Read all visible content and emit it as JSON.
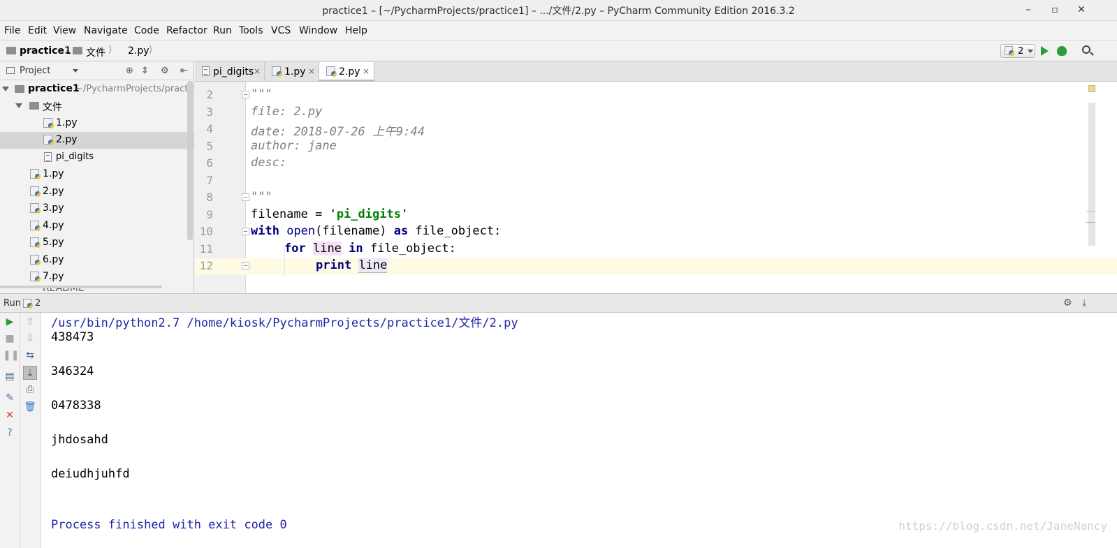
{
  "window": {
    "title": "practice1 – [~/PycharmProjects/practice1] – .../文件/2.py – PyCharm Community Edition 2016.3.2",
    "minimize": "–",
    "maximize": "▫",
    "close": "✕"
  },
  "menu": [
    "File",
    "Edit",
    "View",
    "Navigate",
    "Code",
    "Refactor",
    "Run",
    "Tools",
    "VCS",
    "Window",
    "Help"
  ],
  "breadcrumb": [
    "practice1",
    "文件",
    "2.py"
  ],
  "run_config": {
    "name": "2"
  },
  "project_panel": {
    "title": "Project",
    "root": {
      "name": "practice1",
      "path": "~/PycharmProjects/practic"
    },
    "items": [
      {
        "label": "文件"
      },
      {
        "label": "1.py"
      },
      {
        "label": "2.py",
        "selected": true
      },
      {
        "label": "pi_digits"
      },
      {
        "label": "1.py"
      },
      {
        "label": "2.py"
      },
      {
        "label": "3.py"
      },
      {
        "label": "4.py"
      },
      {
        "label": "5.py"
      },
      {
        "label": "6.py"
      },
      {
        "label": "7.py"
      },
      {
        "label": "README"
      }
    ]
  },
  "tabs": [
    {
      "label": "pi_digits"
    },
    {
      "label": "1.py"
    },
    {
      "label": "2.py",
      "active": true
    }
  ],
  "tab_close": "×",
  "editor": {
    "line_numbers": [
      "2",
      "3",
      "4",
      "5",
      "6",
      "7",
      "8",
      "9",
      "10",
      "11",
      "12"
    ],
    "doc_open": "\"\"\"",
    "doc_file": "file: 2.py",
    "doc_date": "date: 2018-07-26 上午9:44",
    "doc_author": "author: jane",
    "doc_desc": "desc:",
    "doc_close": "\"\"\"",
    "l9_var": "filename = ",
    "l9_str": "'pi_digits'",
    "l10_with": "with",
    "l10_open": "open",
    "l10_mid": "(filename) ",
    "l10_as": "as",
    "l10_end": " file_object:",
    "l11_for": "for",
    "l11_var": "line",
    "l11_in": "in",
    "l11_end": " file_object:",
    "l12_print": "print",
    "l12_var": "line"
  },
  "run_panel": {
    "label": "Run",
    "config": "2"
  },
  "console": {
    "command": "/usr/bin/python2.7 /home/kiosk/PycharmProjects/practice1/文件/2.py",
    "output": [
      "438473",
      "",
      "346324",
      "",
      "0478338",
      "",
      "jhdosahd",
      "",
      "deiudhjuhfd",
      "",
      ""
    ],
    "exit": "Process finished with exit code 0"
  },
  "watermark": "https://blog.csdn.net/JaneNancy"
}
